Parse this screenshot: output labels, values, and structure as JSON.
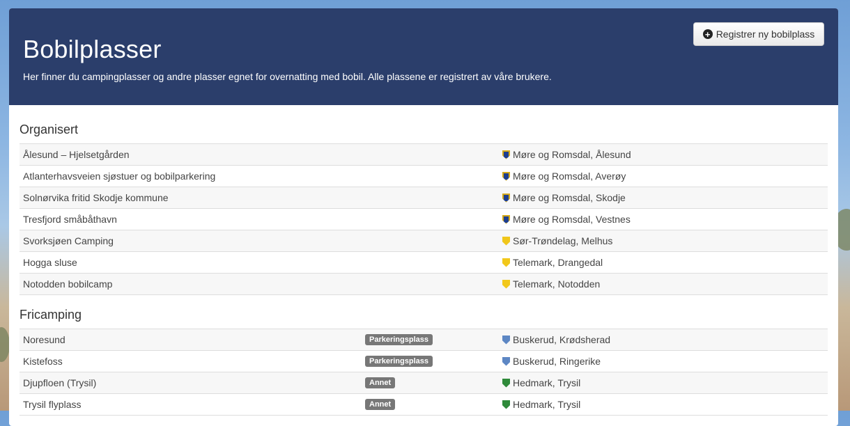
{
  "header": {
    "title": "Bobilplasser",
    "subtitle": "Her finner du campingplasser og andre plasser egnet for overnatting med bobil. Alle plassene er registrert av våre brukere.",
    "register_button": "Registrer ny bobilplass"
  },
  "organisert": {
    "heading": "Organisert",
    "rows": [
      {
        "name": "Ålesund – Hjelsetgården",
        "location": "Møre og Romsdal, Ålesund",
        "icon": "more-og-romsdal-coat-of-arms-icon"
      },
      {
        "name": "Atlanterhavsveien sjøstuer og bobilparkering",
        "location": "Møre og Romsdal, Averøy",
        "icon": "more-og-romsdal-coat-of-arms-icon"
      },
      {
        "name": "Solnørvika fritid Skodje kommune",
        "location": "Møre og Romsdal, Skodje",
        "icon": "more-og-romsdal-coat-of-arms-icon"
      },
      {
        "name": "Tresfjord småbåthavn",
        "location": "Møre og Romsdal, Vestnes",
        "icon": "more-og-romsdal-coat-of-arms-icon"
      },
      {
        "name": "Svorksjøen Camping",
        "location": "Sør-Trøndelag, Melhus",
        "icon": "sor-trondelag-coat-of-arms-icon"
      },
      {
        "name": "Hogga sluse",
        "location": "Telemark, Drangedal",
        "icon": "telemark-coat-of-arms-icon"
      },
      {
        "name": "Notodden bobilcamp",
        "location": "Telemark, Notodden",
        "icon": "telemark-coat-of-arms-icon"
      }
    ]
  },
  "fricamping": {
    "heading": "Fricamping",
    "rows": [
      {
        "name": "Noresund",
        "badge": "Parkeringsplass",
        "location": "Buskerud, Krødsherad",
        "icon": "buskerud-coat-of-arms-icon"
      },
      {
        "name": "Kistefoss",
        "badge": "Parkeringsplass",
        "location": "Buskerud, Ringerike",
        "icon": "buskerud-coat-of-arms-icon"
      },
      {
        "name": "Djupfloen (Trysil)",
        "badge": "Annet",
        "location": "Hedmark, Trysil",
        "icon": "hedmark-coat-of-arms-icon"
      },
      {
        "name": "Trysil flyplass",
        "badge": "Annet",
        "location": "Hedmark, Trysil",
        "icon": "hedmark-coat-of-arms-icon"
      }
    ]
  },
  "colors": {
    "header_bg": "#2b3e6b",
    "badge_bg": "#777777"
  }
}
